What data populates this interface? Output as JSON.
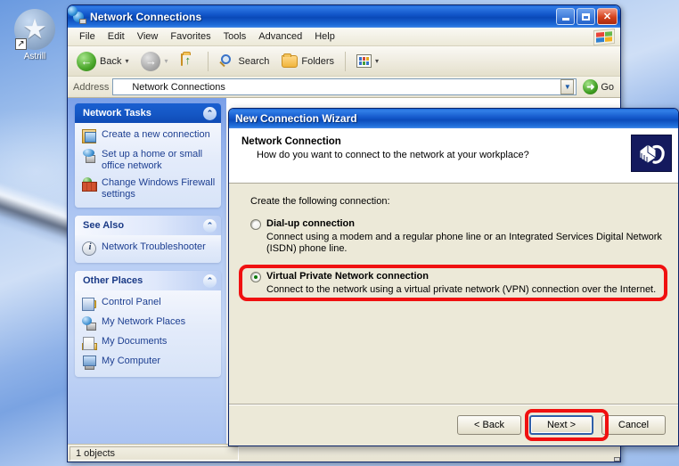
{
  "desktop": {
    "icon": {
      "label": "Astrill",
      "glyph": "★",
      "shortcut_glyph": "↗",
      "name": "astrill-shortcut"
    }
  },
  "explorer": {
    "title": "Network Connections",
    "menu": [
      "File",
      "Edit",
      "View",
      "Favorites",
      "Tools",
      "Advanced",
      "Help"
    ],
    "window_buttons": {
      "minimize": "_",
      "maximize": "□",
      "close": "✕"
    },
    "toolbar": {
      "back_label": "Back",
      "back_caret": "▾",
      "forward_caret": "▾",
      "search_label": "Search",
      "folders_label": "Folders",
      "views_caret": "▾"
    },
    "address": {
      "label": "Address",
      "value": "Network Connections",
      "dropdown_caret": "▼",
      "go_label": "Go",
      "go_glyph": "➜"
    },
    "statusbar": {
      "text": "1 objects"
    },
    "sidebar": {
      "panels": [
        {
          "title": "Network Tasks",
          "style": "dark",
          "collapse_glyph": "⌃",
          "items": [
            {
              "label": "Create a new connection",
              "icon": "new-connection-icon"
            },
            {
              "label": "Set up a home or small office network",
              "icon": "home-network-icon"
            },
            {
              "label": "Change Windows Firewall settings",
              "icon": "firewall-icon"
            }
          ]
        },
        {
          "title": "See Also",
          "style": "light",
          "collapse_glyph": "⌃",
          "items": [
            {
              "label": "Network Troubleshooter",
              "icon": "info-icon"
            }
          ]
        },
        {
          "title": "Other Places",
          "style": "light",
          "collapse_glyph": "⌃",
          "items": [
            {
              "label": "Control Panel",
              "icon": "control-panel-icon"
            },
            {
              "label": "My Network Places",
              "icon": "my-network-places-icon"
            },
            {
              "label": "My Documents",
              "icon": "my-documents-icon"
            },
            {
              "label": "My Computer",
              "icon": "my-computer-icon"
            }
          ]
        }
      ]
    }
  },
  "wizard": {
    "title": "New Connection Wizard",
    "heading": "Network Connection",
    "subheading": "How do you want to connect to the network at your workplace?",
    "header_icon": "network-plug-icon",
    "intro": "Create the following connection:",
    "options": [
      {
        "label": "Dial-up connection",
        "description": "Connect using a modem and a regular phone line or an Integrated Services Digital Network (ISDN) phone line.",
        "selected": false,
        "highlighted": false
      },
      {
        "label": "Virtual Private Network connection",
        "description": "Connect to the network using a virtual private network (VPN) connection over the Internet.",
        "selected": true,
        "highlighted": true
      }
    ],
    "buttons": {
      "back": "< Back",
      "next": "Next >",
      "cancel": "Cancel",
      "next_is_default": true,
      "next_highlighted": true
    }
  },
  "colors": {
    "annotation": "#f01010",
    "titlebar_blue": "#0c4cbb",
    "dialog_face": "#ece9d8",
    "sidebar_link": "#1d3f91"
  }
}
